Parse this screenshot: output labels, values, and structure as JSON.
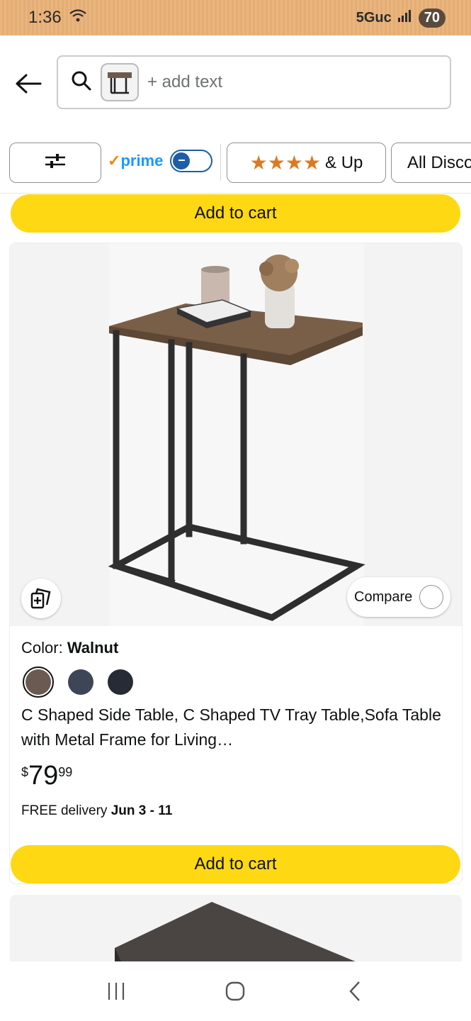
{
  "status": {
    "time": "1:36",
    "network": "5Guc",
    "battery": "70"
  },
  "search": {
    "placeholder": "+ add text"
  },
  "filters": {
    "prime_label": "prime",
    "stars_suffix": "& Up",
    "discount_label": "All Discounts"
  },
  "results": [
    {
      "add_to_cart": "Add to cart"
    },
    {
      "color_label": "Color:",
      "color_value": "Walnut",
      "swatches": [
        "#6b5a52",
        "#3d4656",
        "#262b35"
      ],
      "title": "C Shaped Side Table, C Shaped TV Tray Table,Sofa Table with Metal Frame for Living…",
      "price_symbol": "$",
      "price_whole": "79",
      "price_fraction": "99",
      "delivery_prefix": "FREE delivery",
      "delivery_date": "Jun 3 - 11",
      "compare_label": "Compare",
      "add_to_cart": "Add to cart"
    }
  ],
  "colors": {
    "cart_button": "#ffd814",
    "prime_blue": "#1a98ff",
    "star": "#de7921"
  }
}
